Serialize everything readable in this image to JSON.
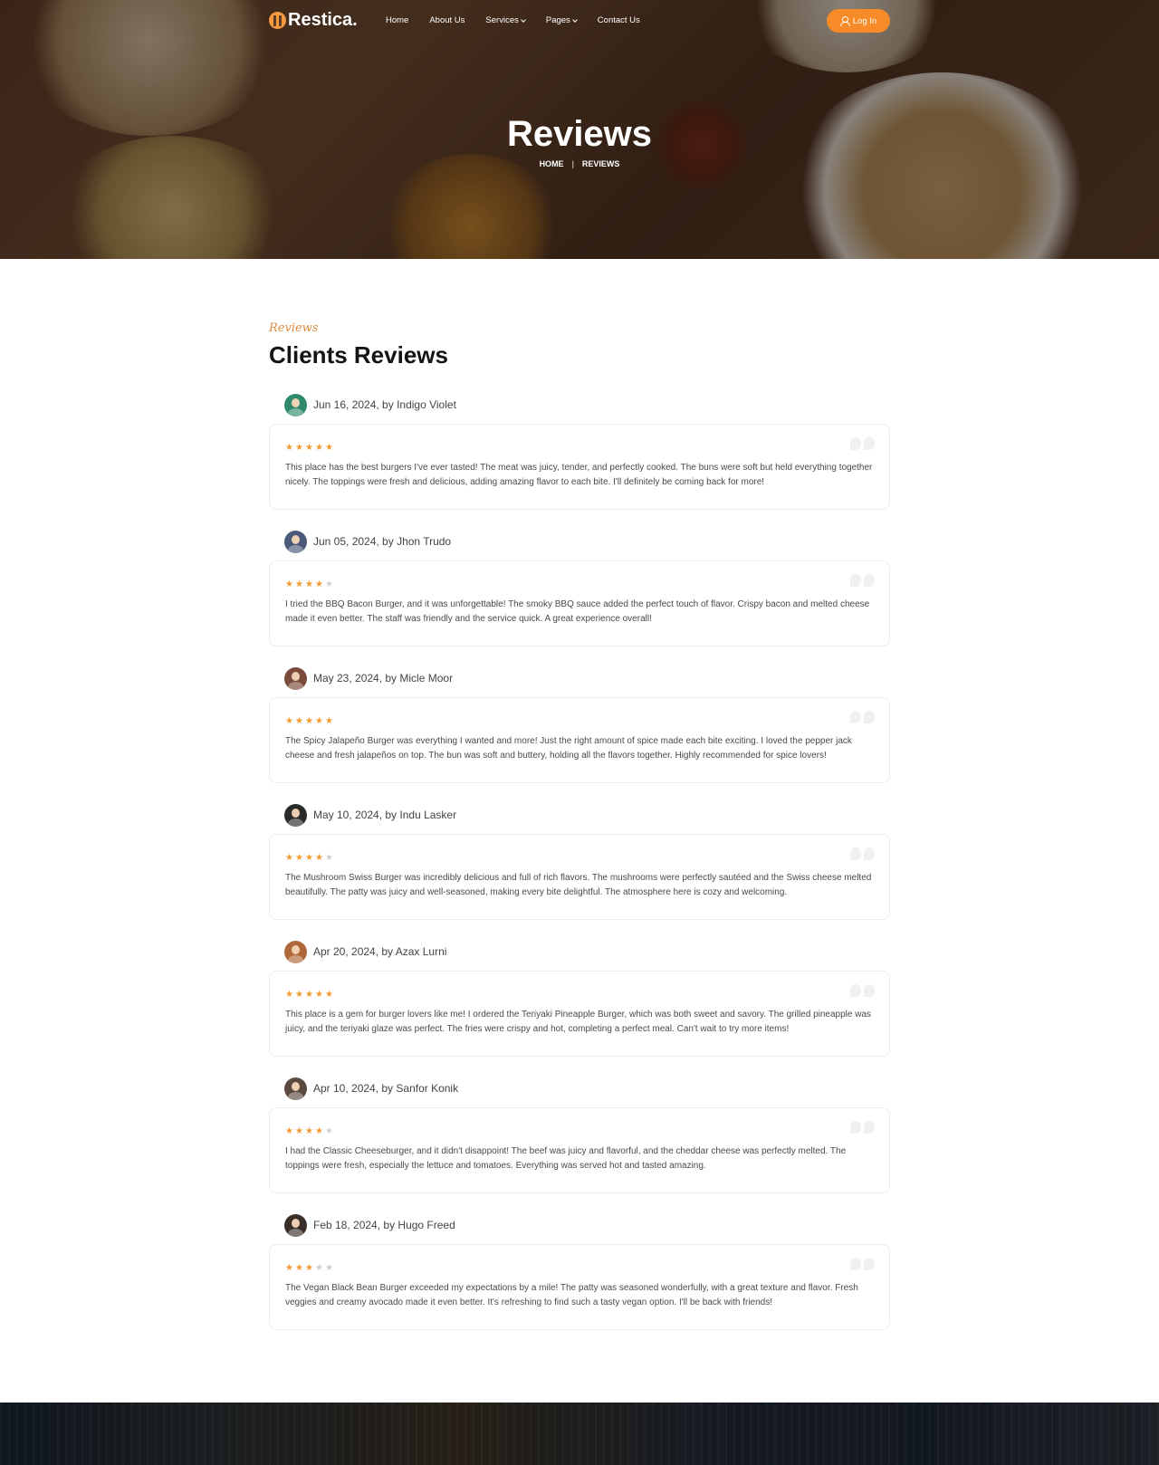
{
  "brand": {
    "name": "Restica.",
    "accent": "#f68b28"
  },
  "nav": {
    "items": [
      {
        "label": "Home",
        "dropdown": false
      },
      {
        "label": "About Us",
        "dropdown": false
      },
      {
        "label": "Services",
        "dropdown": true
      },
      {
        "label": "Pages",
        "dropdown": true
      },
      {
        "label": "Contact Us",
        "dropdown": false
      }
    ],
    "login_label": "Log In"
  },
  "hero": {
    "title": "Reviews",
    "breadcrumb": [
      "HOME",
      "|",
      "REVIEWS"
    ]
  },
  "section": {
    "eyebrow": "Reviews",
    "title": "Clients Reviews"
  },
  "reviews": [
    {
      "meta": "Jun 16, 2024, by Indigo Violet",
      "rating": 5,
      "avatar_color": "#2f8a6a",
      "text": "This place has the best burgers I've ever tasted! The meat was juicy, tender, and perfectly cooked. The buns were soft but held everything together nicely. The toppings were fresh and delicious, adding amazing flavor to each bite. I'll definitely be coming back for more!"
    },
    {
      "meta": "Jun 05, 2024, by Jhon Trudo",
      "rating": 4,
      "avatar_color": "#4a5a78",
      "text": "I tried the BBQ Bacon Burger, and it was unforgettable! The smoky BBQ sauce added the perfect touch of flavor. Crispy bacon and melted cheese made it even better. The staff was friendly and the service quick. A great experience overall!"
    },
    {
      "meta": "May 23, 2024, by Micle Moor",
      "rating": 5,
      "avatar_color": "#7a4a3a",
      "text": "The Spicy Jalapeño Burger was everything I wanted and more! Just the right amount of spice made each bite exciting. I loved the pepper jack cheese and fresh jalapeños on top. The bun was soft and buttery, holding all the flavors together. Highly recommended for spice lovers!"
    },
    {
      "meta": "May 10, 2024, by Indu Lasker",
      "rating": 4,
      "avatar_color": "#2a2a2a",
      "text": "The Mushroom Swiss Burger was incredibly delicious and full of rich flavors. The mushrooms were perfectly sautéed and the Swiss cheese melted beautifully. The patty was juicy and well-seasoned, making every bite delightful. The atmosphere here is cozy and welcoming."
    },
    {
      "meta": "Apr 20, 2024, by Azax Lurni",
      "rating": 5,
      "avatar_color": "#b0683a",
      "text": "This place is a gem for burger lovers like me! I ordered the Teriyaki Pineapple Burger, which was both sweet and savory. The grilled pineapple was juicy, and the teriyaki glaze was perfect. The fries were crispy and hot, completing a perfect meal. Can't wait to try more items!"
    },
    {
      "meta": "Apr 10, 2024, by Sanfor Konik",
      "rating": 4,
      "avatar_color": "#5a4a40",
      "text": "I had the Classic Cheeseburger, and it didn't disappoint! The beef was juicy and flavorful, and the cheddar cheese was perfectly melted. The toppings were fresh, especially the lettuce and tomatoes. Everything was served hot and tasted amazing."
    },
    {
      "meta": "Feb 18, 2024, by Hugo Freed",
      "rating": 3,
      "avatar_color": "#3a2e28",
      "text": "The Vegan Black Bean Burger exceeded my expectations by a mile! The patty was seasoned wonderfully, with a great texture and flavor. Fresh veggies and creamy avocado made it even better. It's refreshing to find such a tasty vegan option. I'll be back with friends!"
    }
  ]
}
